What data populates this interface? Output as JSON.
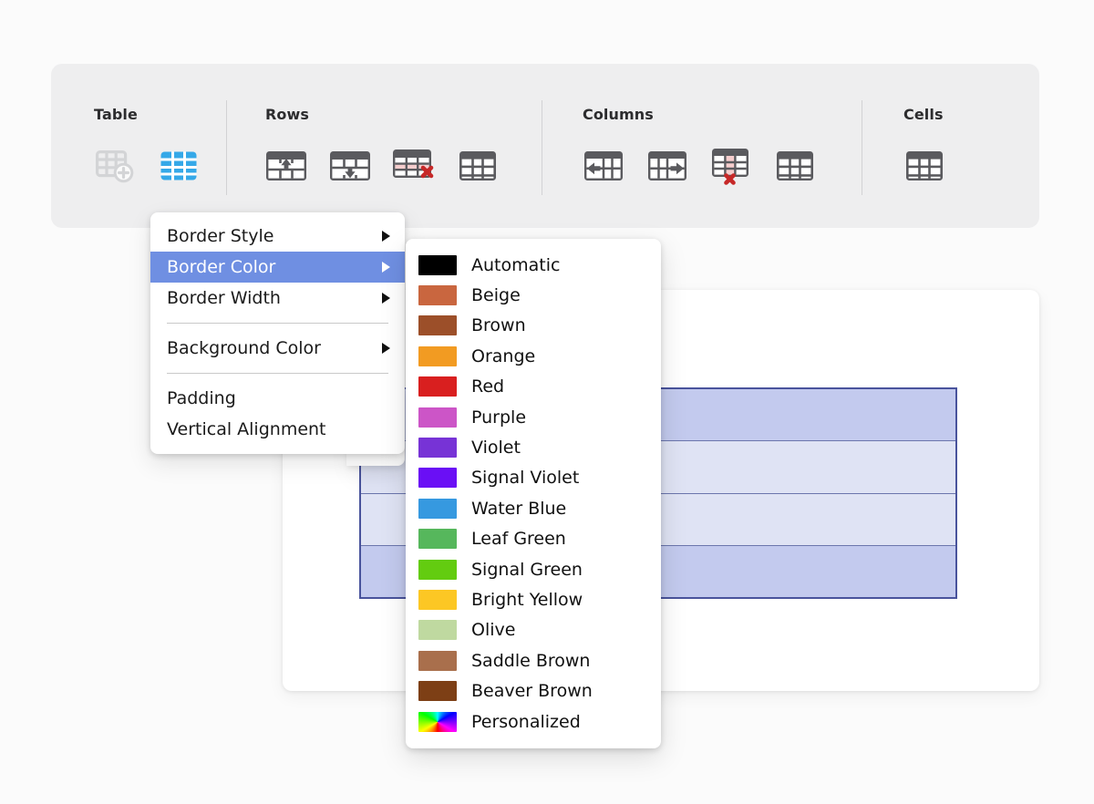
{
  "toolbar": {
    "groups": [
      {
        "title": "Table",
        "buttons": [
          {
            "name": "insert-table-icon",
            "state": "disabled"
          },
          {
            "name": "table-properties-icon",
            "state": "active"
          }
        ]
      },
      {
        "title": "Rows",
        "buttons": [
          {
            "name": "insert-row-above-icon",
            "state": "normal"
          },
          {
            "name": "insert-row-below-icon",
            "state": "normal"
          },
          {
            "name": "delete-row-icon",
            "state": "normal"
          },
          {
            "name": "optimize-rows-icon",
            "state": "normal"
          }
        ]
      },
      {
        "title": "Columns",
        "buttons": [
          {
            "name": "insert-column-before-icon",
            "state": "normal"
          },
          {
            "name": "insert-column-after-icon",
            "state": "normal"
          },
          {
            "name": "delete-column-icon",
            "state": "normal"
          },
          {
            "name": "optimize-columns-icon",
            "state": "normal"
          }
        ]
      },
      {
        "title": "Cells",
        "buttons": [
          {
            "name": "merge-cells-icon",
            "state": "normal"
          }
        ]
      }
    ]
  },
  "context_menu": {
    "items": [
      {
        "label": "Border Style",
        "submenu": true,
        "highlighted": false
      },
      {
        "label": "Border Color",
        "submenu": true,
        "highlighted": true
      },
      {
        "label": "Border Width",
        "submenu": true,
        "highlighted": false
      },
      {
        "label": "Background Color",
        "submenu": true,
        "highlighted": false
      },
      {
        "label": "Padding",
        "submenu": true,
        "highlighted": false
      },
      {
        "label": "Vertical Alignment",
        "submenu": true,
        "highlighted": false
      }
    ],
    "highlight_color": "#6f8fe2"
  },
  "color_menu": {
    "items": [
      {
        "label": "Automatic",
        "color": "#000000"
      },
      {
        "label": "Beige",
        "color": "#c9663f"
      },
      {
        "label": "Brown",
        "color": "#9c4f29"
      },
      {
        "label": "Orange",
        "color": "#f29b22"
      },
      {
        "label": "Red",
        "color": "#d91f1f"
      },
      {
        "label": "Purple",
        "color": "#cc55c7"
      },
      {
        "label": "Violet",
        "color": "#7733d6"
      },
      {
        "label": "Signal Violet",
        "color": "#6a0ff5"
      },
      {
        "label": "Water Blue",
        "color": "#3699e0"
      },
      {
        "label": "Leaf Green",
        "color": "#56b75c"
      },
      {
        "label": "Signal Green",
        "color": "#63cc10"
      },
      {
        "label": "Bright Yellow",
        "color": "#fcc724"
      },
      {
        "label": "Olive",
        "color": "#bfd9a0"
      },
      {
        "label": "Saddle Brown",
        "color": "#a96f4c"
      },
      {
        "label": "Beaver Brown",
        "color": "#7d3f15"
      },
      {
        "label": "Personalized",
        "color": "rainbow"
      }
    ]
  },
  "document": {
    "table": {
      "rows": 4,
      "columns": 2,
      "selected_rows": [
        0,
        3
      ],
      "border_color": "#49539c",
      "selected_fill": "#c3caee",
      "cell_fill": "#dfe3f4"
    }
  }
}
